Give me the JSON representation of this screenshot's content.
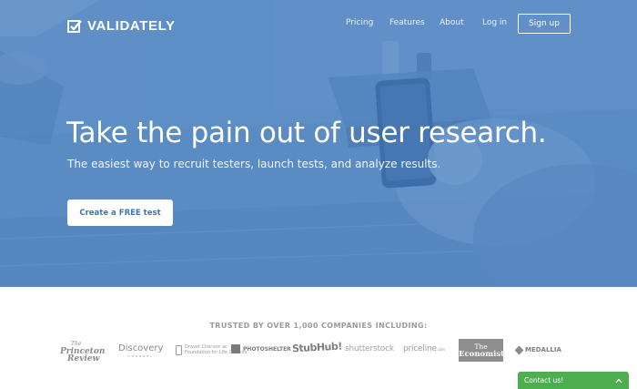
{
  "brand": {
    "name": "VALIDATELY",
    "logo_icon": "checkbox-icon"
  },
  "nav": {
    "items": [
      {
        "label": "Pricing"
      },
      {
        "label": "Features"
      },
      {
        "label": "About"
      },
      {
        "label": "Log in"
      }
    ],
    "signup_label": "Sign up"
  },
  "hero": {
    "headline": "Take the pain out of user research.",
    "subheadline": "The easiest way to recruit testers, launch tests, and analyze results.",
    "cta_label": "Create a FREE test",
    "overlay_color": "#5b8cc4"
  },
  "trusted": {
    "heading": "TRUSTED BY OVER 1,000 COMPANIES INCLUDING:",
    "logos": {
      "princeton": {
        "line1": "The",
        "line2": "Princeton",
        "line3": "Review"
      },
      "discovery": {
        "name": "Discovery",
        "sub": "CHANNEL"
      },
      "dcf": {
        "line1": "Dravet Chervon ac",
        "line2": "Foundation for Life Choices"
      },
      "photoshelter": "PHOTOSHELTER",
      "stubhub": "StubHub!",
      "shutterstock": "shutterstock",
      "priceline": {
        "name": "priceline",
        "suffix": ".com"
      },
      "economist": {
        "line1": "The",
        "line2": "Economist"
      },
      "medallia": "MEDALLIA"
    }
  },
  "contact": {
    "label": "Contact us!",
    "color": "#4cae4f"
  }
}
